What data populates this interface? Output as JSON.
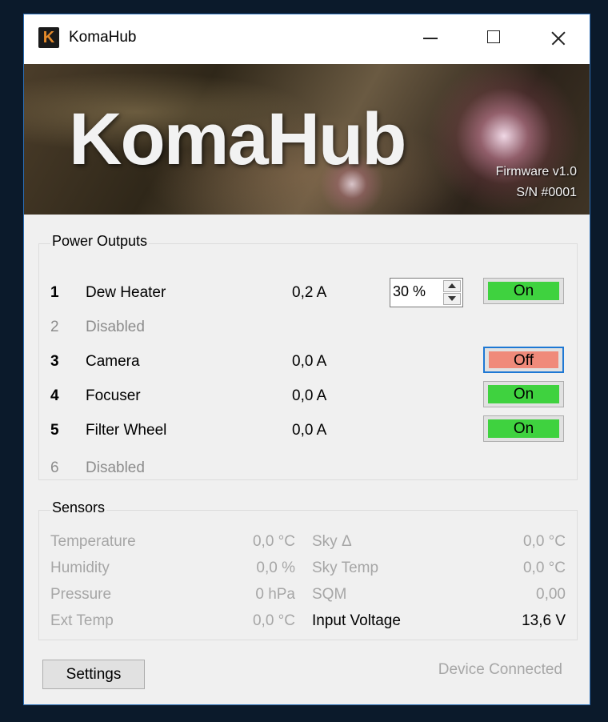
{
  "window": {
    "title": "KomaHub",
    "icon_glyph": "K",
    "icon_name": "komahub-app-icon"
  },
  "banner": {
    "title": "KomaHub",
    "firmware": "Firmware v1.0",
    "serial": "S/N #0001"
  },
  "power": {
    "label": "Power Outputs",
    "rows": [
      {
        "num": "1",
        "name": "Dew Heater",
        "amp": "0,2 A",
        "pwm": "30 %",
        "state": "On"
      },
      {
        "num": "2",
        "name": "Disabled",
        "amp": "",
        "pwm": "",
        "state": ""
      },
      {
        "num": "3",
        "name": "Camera",
        "amp": "0,0 A",
        "pwm": "",
        "state": "Off"
      },
      {
        "num": "4",
        "name": "Focuser",
        "amp": "0,0 A",
        "pwm": "",
        "state": "On"
      },
      {
        "num": "5",
        "name": "Filter Wheel",
        "amp": "0,0 A",
        "pwm": "",
        "state": "On"
      },
      {
        "num": "6",
        "name": "Disabled",
        "amp": "",
        "pwm": "",
        "state": ""
      }
    ]
  },
  "sensors": {
    "label": "Sensors",
    "rows": [
      {
        "k1": "Temperature",
        "v1": "0,0 °C",
        "k2": "Sky Δ",
        "v2": "0,0 °C"
      },
      {
        "k1": "Humidity",
        "v1": "0,0 %",
        "k2": "Sky Temp",
        "v2": "0,0 °C"
      },
      {
        "k1": "Pressure",
        "v1": "0 hPa",
        "k2": "SQM",
        "v2": "0,00"
      },
      {
        "k1": "Ext Temp",
        "v1": "0,0 °C",
        "k2": "Input Voltage",
        "v2": "13,6 V"
      }
    ]
  },
  "footer": {
    "settings_label": "Settings",
    "status": "Device Connected"
  },
  "colors": {
    "on": "#3fd23f",
    "off": "#f08a7a",
    "focus": "#1e78d4",
    "disabled_text": "#8c8c8c"
  }
}
